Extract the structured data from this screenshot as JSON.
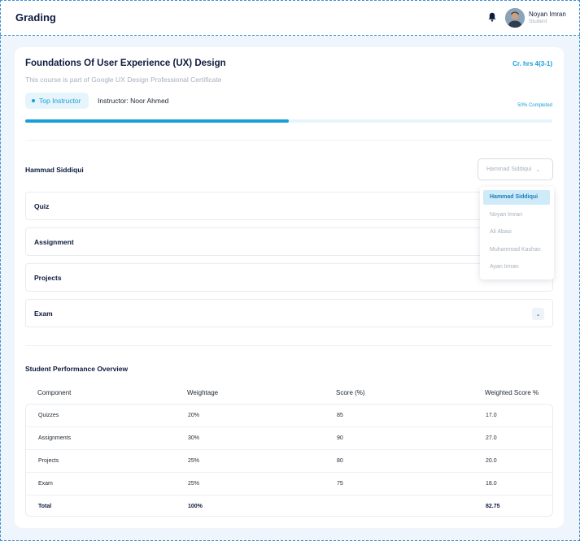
{
  "header": {
    "title": "Grading",
    "user_name": "Noyan Imran",
    "user_role": "Student"
  },
  "course": {
    "title": "Foundations Of User Experience (UX) Design",
    "credit_hours": "Cr. hrs 4(3-1)",
    "subtitle": "This course is part of Google UX Design Professional Certificate",
    "badge": "Top Instructor",
    "instructor": "Instructor: Noor Ahmed",
    "progress_label": "50% Completed",
    "progress_percent": 50
  },
  "student": {
    "name": "Hammad Siddiqui",
    "selected": "Hammad Siddiqui",
    "options": [
      "Hammad Siddiqui",
      "Noyan Imran",
      "Ali Abasi",
      "Muhammad Kashan",
      "Ayan Imran"
    ]
  },
  "sections": [
    "Quiz",
    "Assignment",
    "Projects",
    "Exam"
  ],
  "performance": {
    "title": "Student Performance Overview",
    "headers": [
      "Component",
      "Weightage",
      "Score (%)",
      "Weighted Score %"
    ],
    "rows": [
      [
        "Quizzes",
        "20%",
        "85",
        "17.0"
      ],
      [
        "Assignments",
        "30%",
        "90",
        "27.0"
      ],
      [
        "Projects",
        "25%",
        "80",
        "20.0"
      ],
      [
        "Exam",
        "25%",
        "75",
        "18.0"
      ],
      [
        "Total",
        "100%",
        "",
        "82.75"
      ]
    ]
  },
  "colors": {
    "accent": "#1a9ed9",
    "text": "#0d1b3e",
    "muted": "#a6b0bd",
    "background": "#eef5fd"
  },
  "icons": {
    "bell": "bell-icon",
    "chevron": "chevron-down-icon",
    "avatar": "avatar"
  }
}
